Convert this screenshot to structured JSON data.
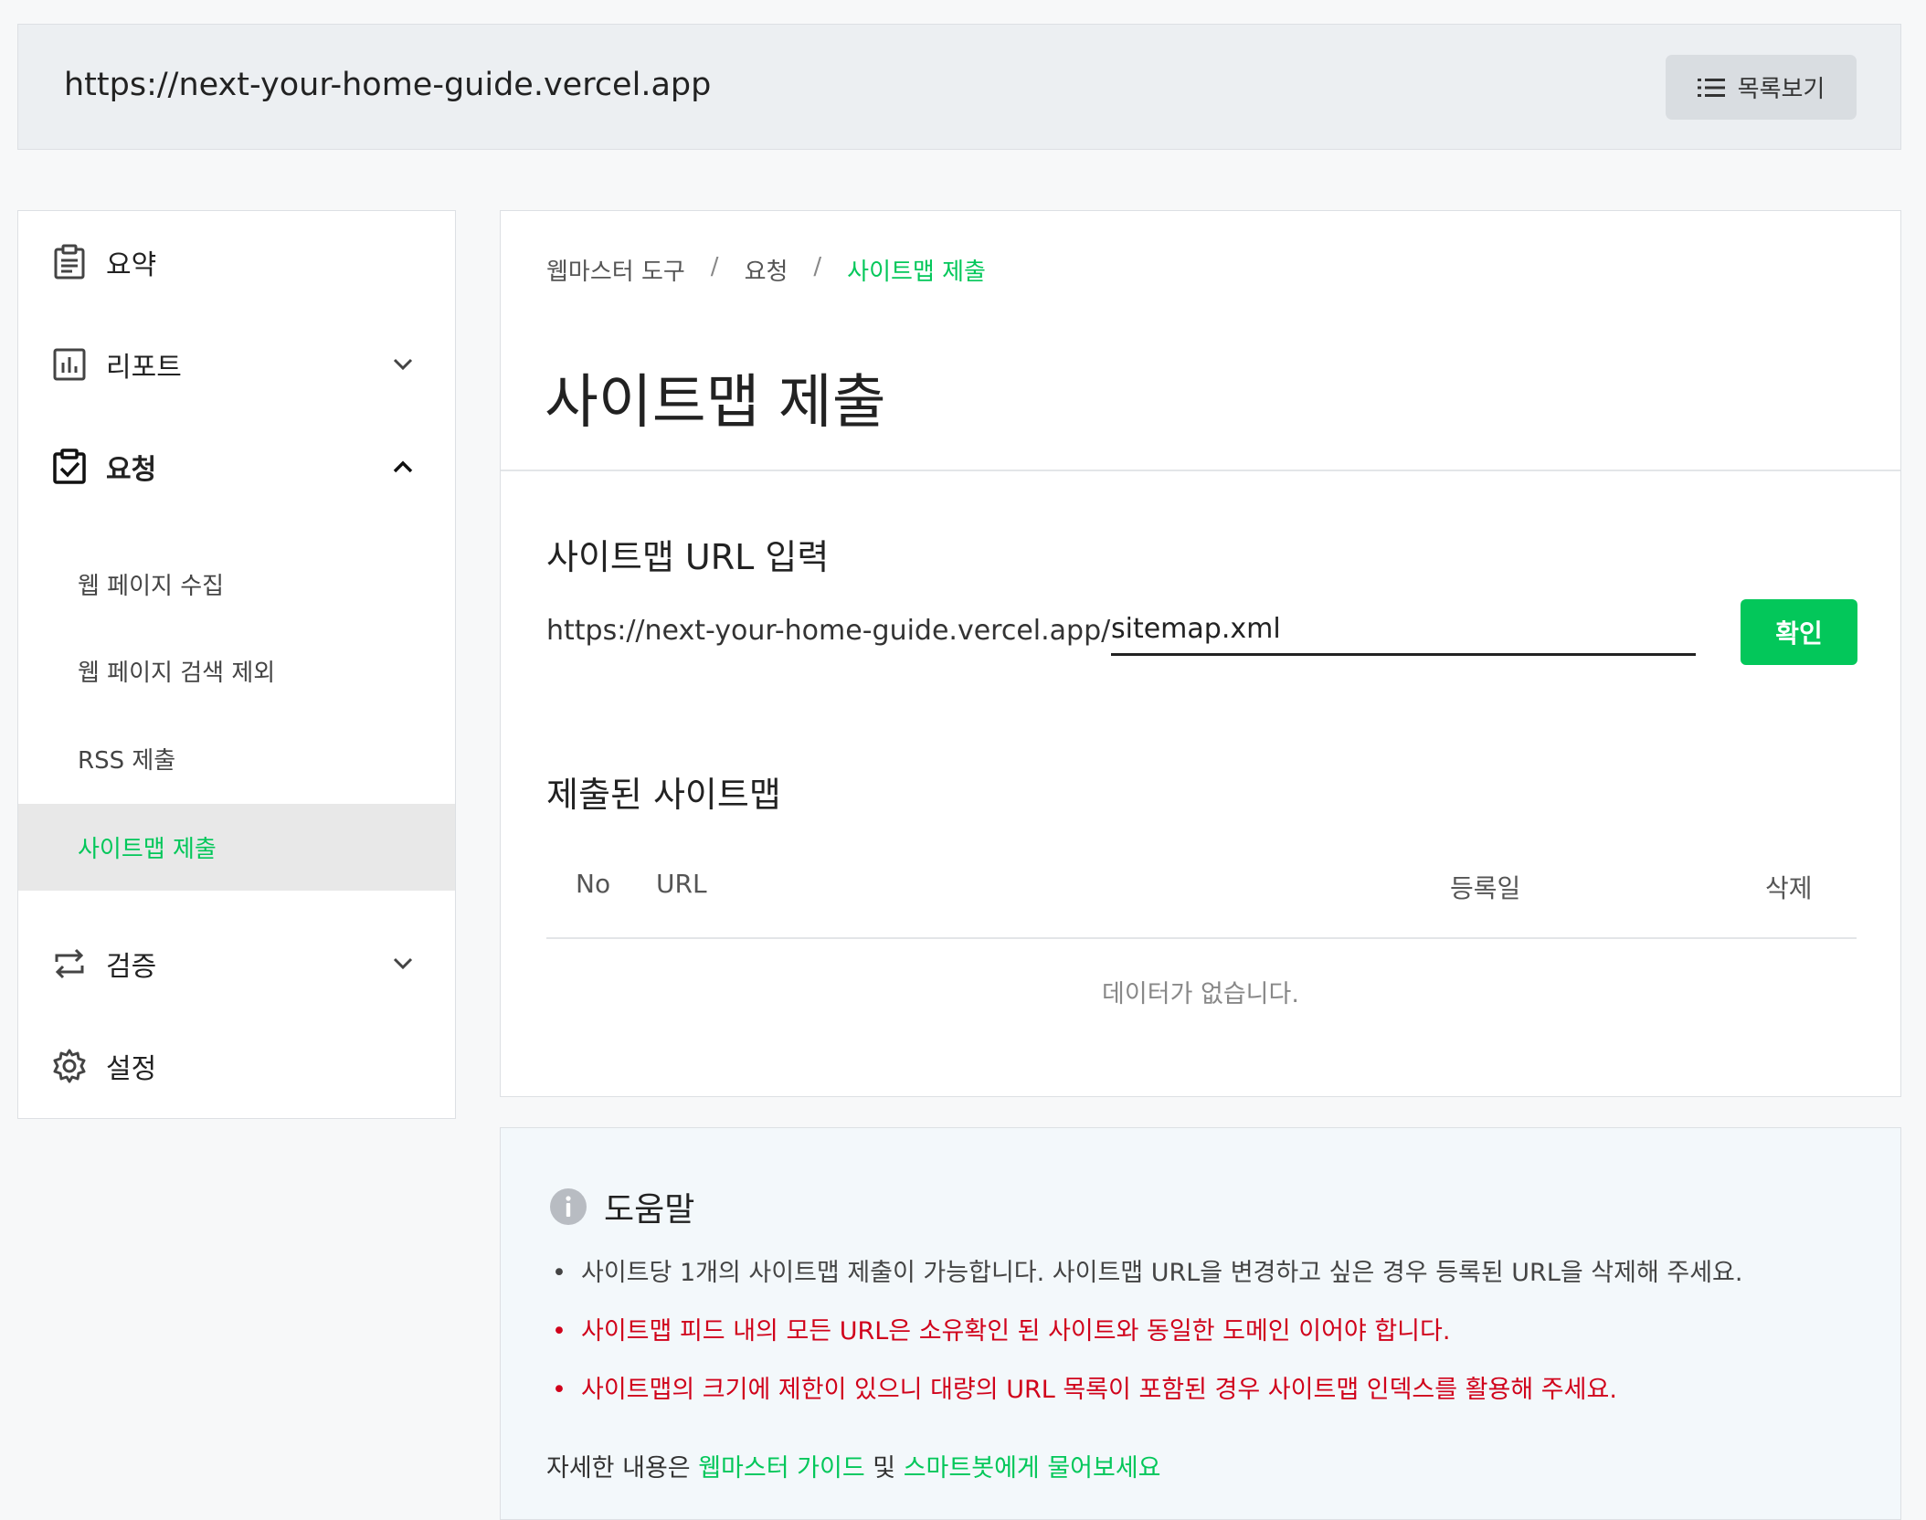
{
  "site_bar": {
    "url": "https://next-your-home-guide.vercel.app",
    "list_button_label": "목록보기"
  },
  "sidebar": {
    "items": [
      {
        "label": "요약",
        "icon": "clipboard-list-icon"
      },
      {
        "label": "리포트",
        "icon": "bar-chart-icon",
        "expanded": false
      },
      {
        "label": "요청",
        "icon": "clipboard-check-icon",
        "expanded": true
      },
      {
        "label": "검증",
        "icon": "repeat-arrows-icon",
        "expanded": false
      },
      {
        "label": "설정",
        "icon": "gear-icon"
      }
    ],
    "sub_items": [
      {
        "label": "웹 페이지 수집"
      },
      {
        "label": "웹 페이지 검색 제외"
      },
      {
        "label": "RSS 제출"
      },
      {
        "label": "사이트맵 제출",
        "active": true
      }
    ]
  },
  "main": {
    "breadcrumb": [
      "웹마스터 도구",
      "요청",
      "사이트맵 제출"
    ],
    "breadcrumb_separator": "/",
    "title": "사이트맵 제출",
    "url_section": {
      "title": "사이트맵 URL 입력",
      "prefix": "https://next-your-home-guide.vercel.app/",
      "input_value": "sitemap.xml",
      "confirm_label": "확인"
    },
    "submitted_section": {
      "title": "제출된 사이트맵",
      "columns": [
        "No",
        "URL",
        "등록일",
        "삭제"
      ],
      "rows": [],
      "empty_message": "데이터가 없습니다."
    }
  },
  "help": {
    "title": "도움말",
    "items": [
      {
        "text": "사이트당 1개의 사이트맵 제출이 가능합니다. 사이트맵 URL을 변경하고 싶은 경우 등록된 URL을 삭제해 주세요.",
        "type": "normal"
      },
      {
        "text": "사이트맵 피드 내의 모든 URL은 소유확인 된 사이트와 동일한 도메인 이어야 합니다.",
        "type": "warn"
      },
      {
        "text": "사이트맵의 크기에 제한이 있으니 대량의 URL 목록이 포함된 경우 사이트맵 인덱스를 활용해 주세요.",
        "type": "warn"
      }
    ],
    "footer_prefix": "자세한 내용은 ",
    "footer_link1": "웹마스터 가이드",
    "footer_mid": " 및 ",
    "footer_link2": "스마트봇에게 물어보세요"
  },
  "colors": {
    "accent": "#03c75a",
    "warning": "#d0021b",
    "active_bg": "#e8e8e8"
  }
}
